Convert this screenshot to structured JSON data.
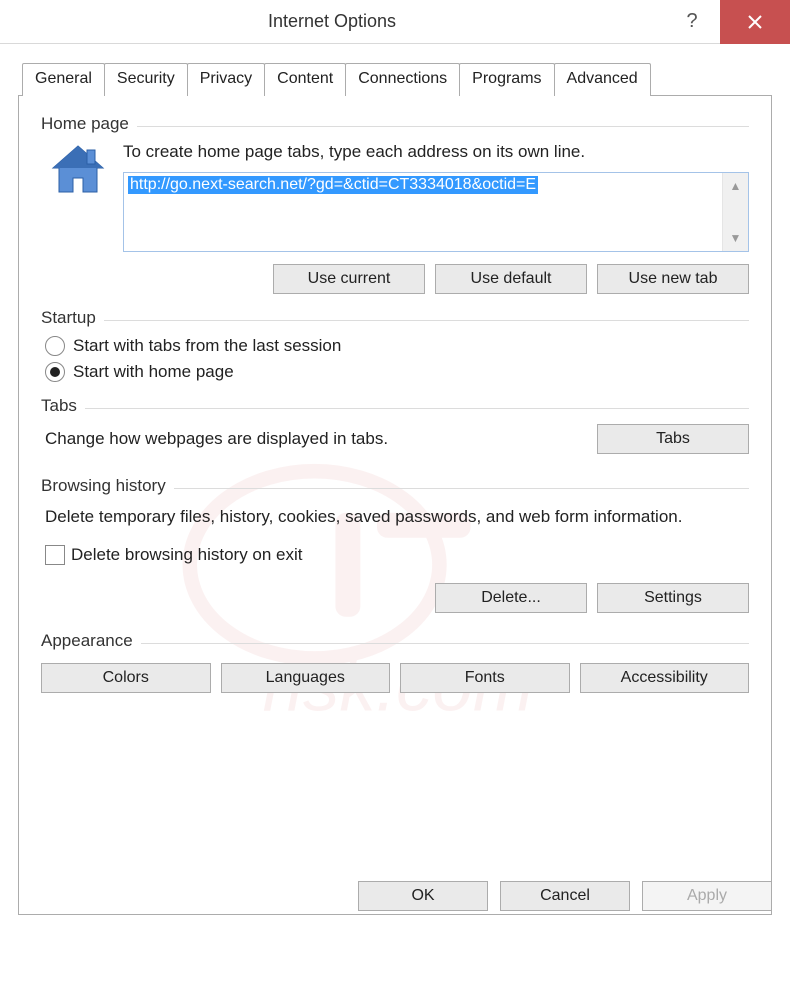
{
  "window": {
    "title": "Internet Options"
  },
  "tabs": [
    "General",
    "Security",
    "Privacy",
    "Content",
    "Connections",
    "Programs",
    "Advanced"
  ],
  "active_tab": 0,
  "homepage": {
    "label": "Home page",
    "instruction": "To create home page tabs, type each address on its own line.",
    "url": "http://go.next-search.net/?gd=&ctid=CT3334018&octid=E",
    "buttons": {
      "use_current": "Use current",
      "use_default": "Use default",
      "use_new_tab": "Use new tab"
    }
  },
  "startup": {
    "label": "Startup",
    "option_last_session": "Start with tabs from the last session",
    "option_home_page": "Start with home page",
    "selected": "home_page"
  },
  "tabs_section": {
    "label": "Tabs",
    "description": "Change how webpages are displayed in tabs.",
    "button": "Tabs"
  },
  "browsing_history": {
    "label": "Browsing history",
    "description": "Delete temporary files, history, cookies, saved passwords, and web form information.",
    "checkbox_label": "Delete browsing history on exit",
    "checkbox_checked": false,
    "delete_button": "Delete...",
    "settings_button": "Settings"
  },
  "appearance": {
    "label": "Appearance",
    "colors": "Colors",
    "languages": "Languages",
    "fonts": "Fonts",
    "accessibility": "Accessibility"
  },
  "footer": {
    "ok": "OK",
    "cancel": "Cancel",
    "apply": "Apply"
  }
}
